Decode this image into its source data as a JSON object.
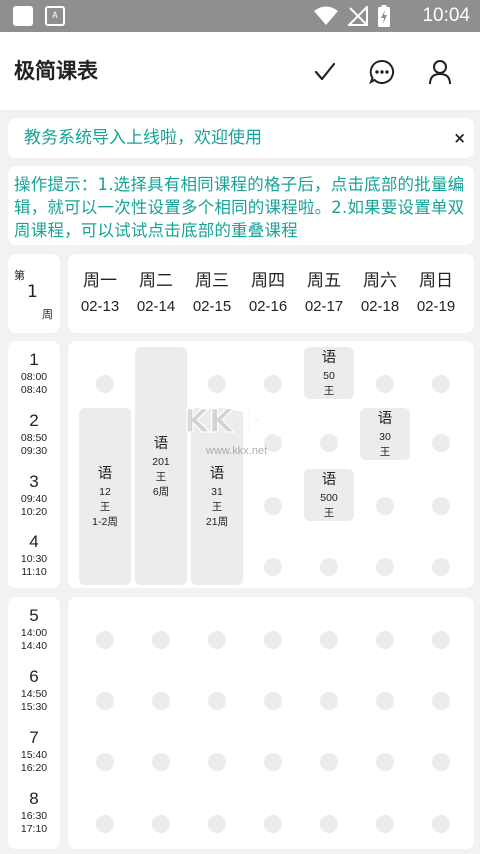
{
  "status_bar": {
    "time": "10:04",
    "notif_icon": "A"
  },
  "app_bar": {
    "title": "极简课表"
  },
  "banner": {
    "text": "教务系统导入上线啦，欢迎使用",
    "close": "×"
  },
  "tip": {
    "text": "操作提示：1.选择具有相同课程的格子后，点击底部的批量编辑，就可以一次性设置多个相同的课程啦。2.如果要设置单双周课程，可以试试点击底部的重叠课程"
  },
  "week": {
    "label_top": "第",
    "number": "1",
    "label_bottom": "周"
  },
  "days": [
    {
      "name": "周一",
      "date": "02-13"
    },
    {
      "name": "周二",
      "date": "02-14"
    },
    {
      "name": "周三",
      "date": "02-15"
    },
    {
      "name": "周四",
      "date": "02-16"
    },
    {
      "name": "周五",
      "date": "02-17"
    },
    {
      "name": "周六",
      "date": "02-18"
    },
    {
      "name": "周日",
      "date": "02-19"
    }
  ],
  "slots": [
    {
      "num": "1",
      "start": "08:00",
      "end": "08:40"
    },
    {
      "num": "2",
      "start": "08:50",
      "end": "09:30"
    },
    {
      "num": "3",
      "start": "09:40",
      "end": "10:20"
    },
    {
      "num": "4",
      "start": "10:30",
      "end": "11:10"
    },
    {
      "num": "5",
      "start": "14:00",
      "end": "14:40"
    },
    {
      "num": "6",
      "start": "14:50",
      "end": "15:30"
    },
    {
      "num": "7",
      "start": "15:40",
      "end": "16:20"
    },
    {
      "num": "8",
      "start": "16:30",
      "end": "17:10"
    }
  ],
  "courses": [
    {
      "day": 1,
      "start": 2,
      "end": 4,
      "name": "语",
      "room": "12",
      "teacher": "王",
      "weeks": "1-2周"
    },
    {
      "day": 2,
      "start": 1,
      "end": 4,
      "name": "语",
      "room": "201",
      "teacher": "王",
      "weeks": "6周"
    },
    {
      "day": 3,
      "start": 2,
      "end": 4,
      "name": "语",
      "room": "31",
      "teacher": "王",
      "weeks": "21周"
    },
    {
      "day": 5,
      "start": 1,
      "end": 1,
      "name": "语",
      "room": "50",
      "teacher": "王",
      "weeks": ""
    },
    {
      "day": 5,
      "start": 3,
      "end": 3,
      "name": "语",
      "room": "500",
      "teacher": "王",
      "weeks": ""
    },
    {
      "day": 6,
      "start": 2,
      "end": 2,
      "name": "语",
      "room": "30",
      "teacher": "王",
      "weeks": ""
    }
  ],
  "watermark": {
    "logo": "KK下载",
    "url": "www.kkx.net"
  }
}
